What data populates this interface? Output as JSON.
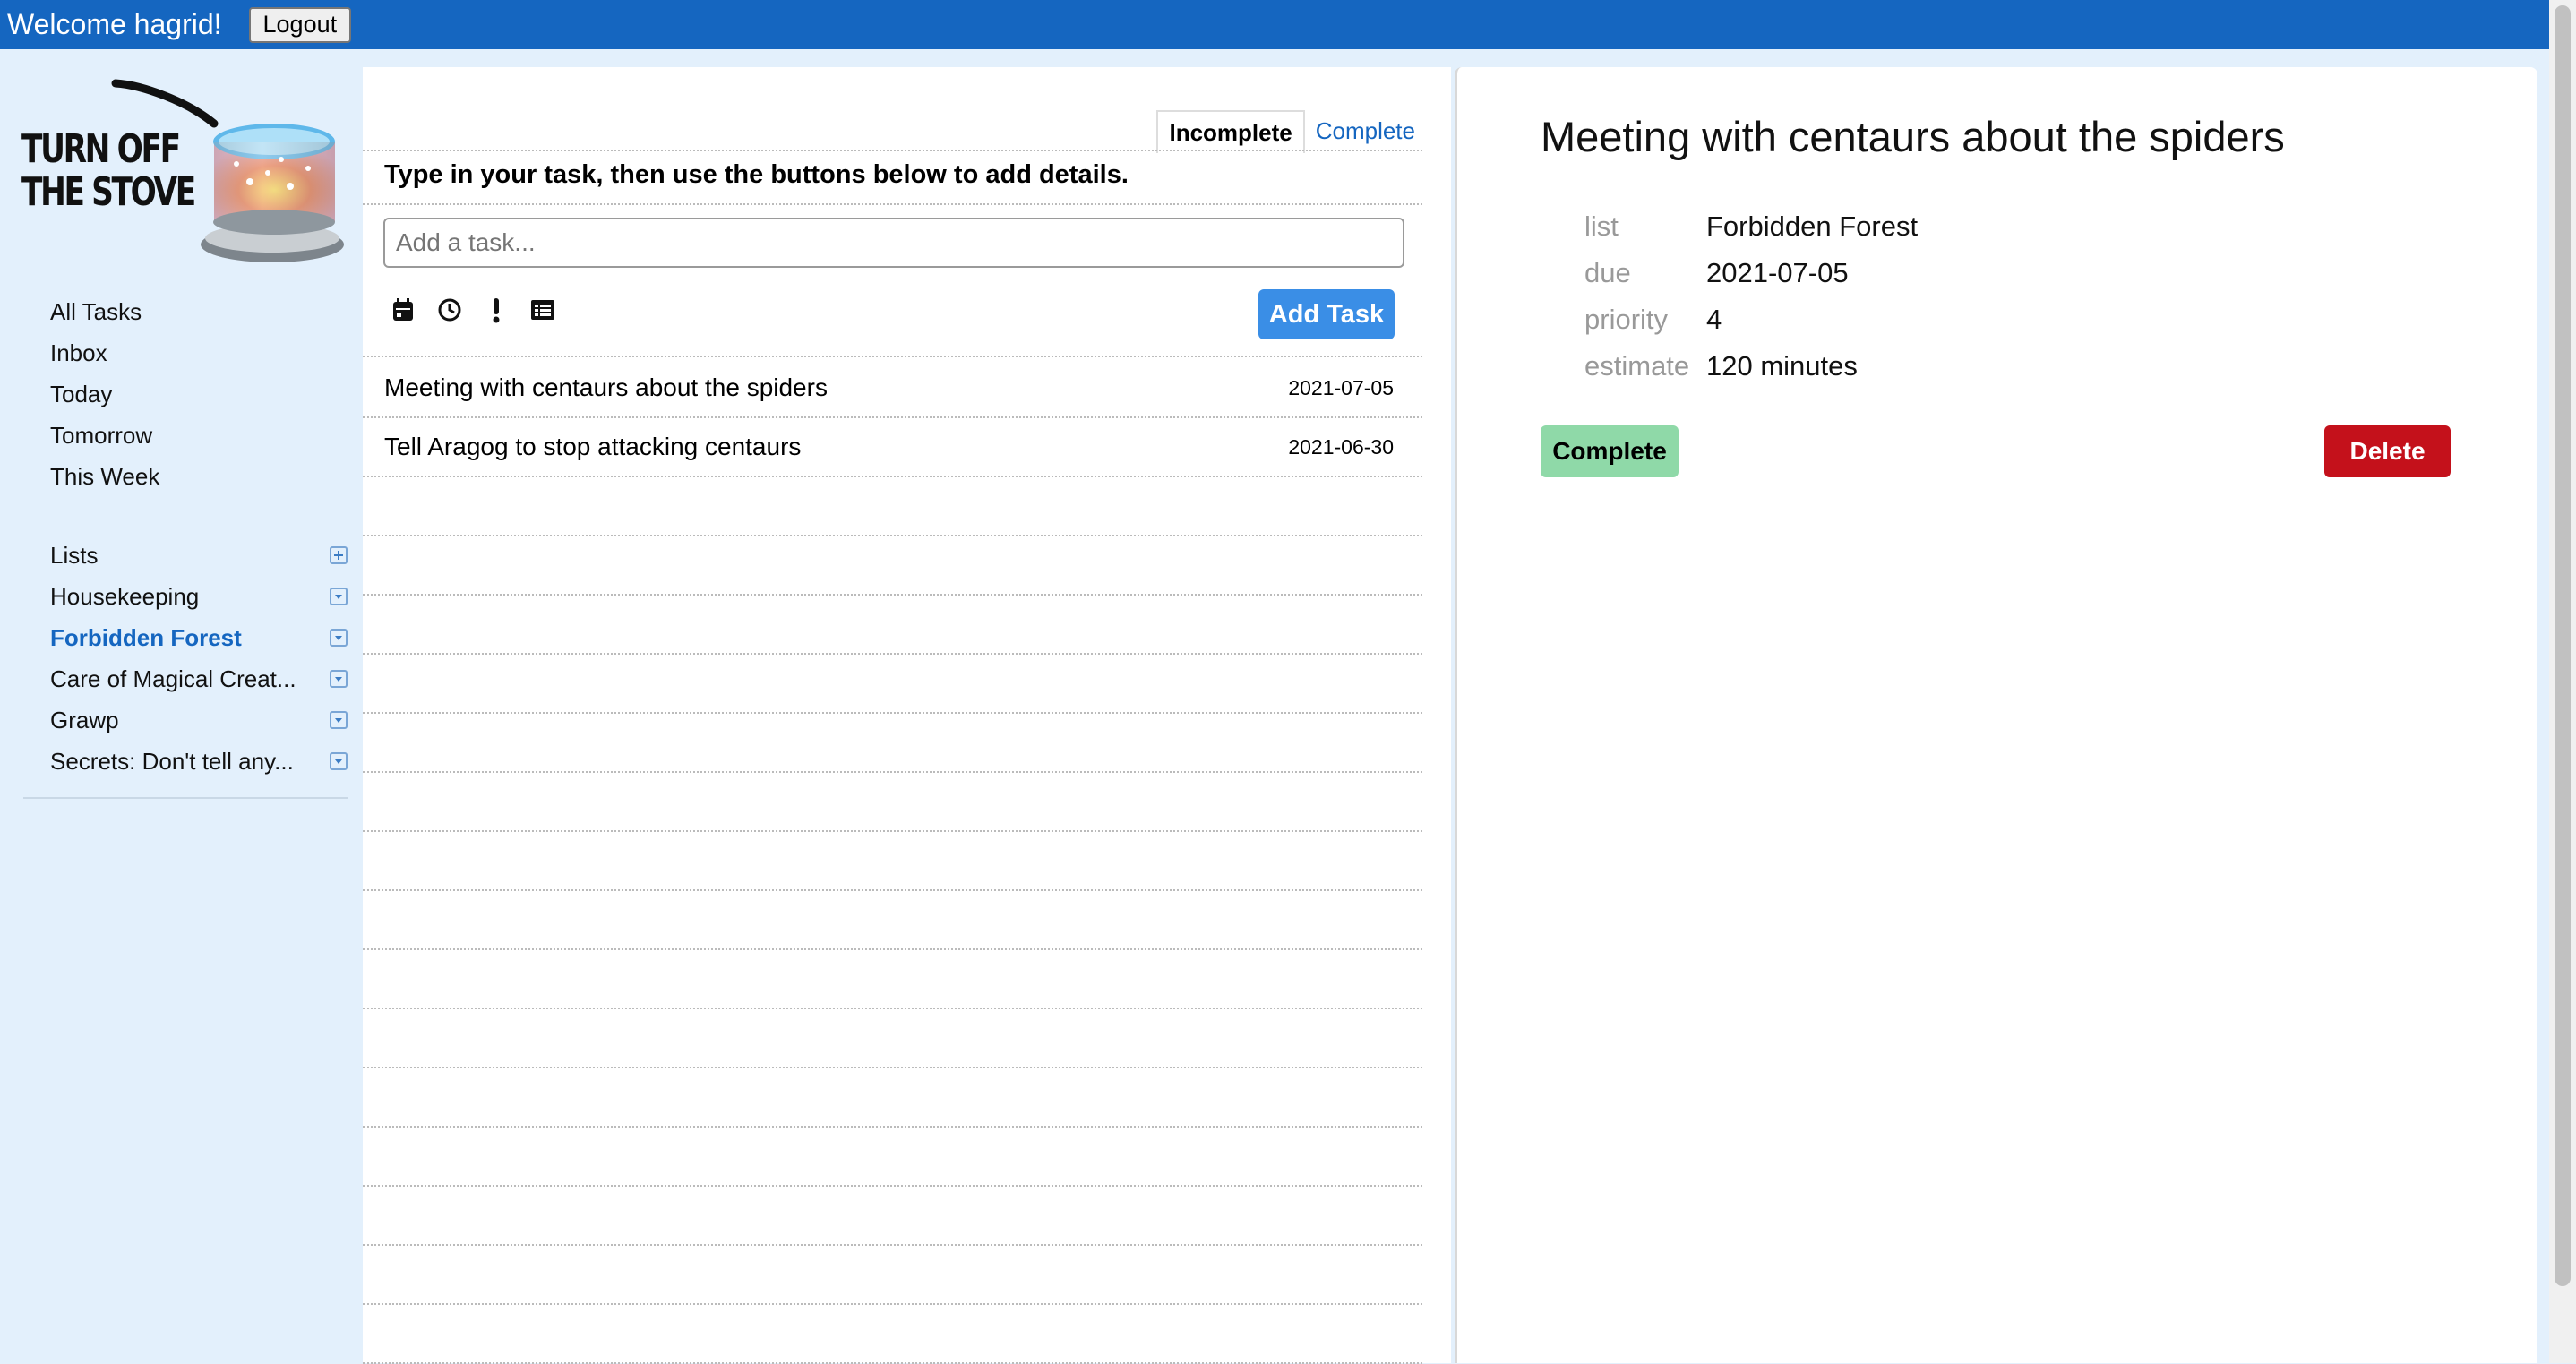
{
  "header": {
    "welcome": "Welcome hagrid!",
    "logout_label": "Logout"
  },
  "logo": {
    "line1": "TURN OFF",
    "line2": "THE STOVE"
  },
  "nav": {
    "items": [
      "All Tasks",
      "Inbox",
      "Today",
      "Tomorrow",
      "This Week"
    ]
  },
  "lists": {
    "header": "Lists",
    "items": [
      {
        "name": "Housekeeping",
        "active": false
      },
      {
        "name": "Forbidden Forest",
        "active": true
      },
      {
        "name": "Care of Magical Creat...",
        "active": false
      },
      {
        "name": "Grawp",
        "active": false
      },
      {
        "name": "Secrets: Don't tell any...",
        "active": false
      }
    ]
  },
  "tasks_panel": {
    "tabs": {
      "incomplete": "Incomplete",
      "complete": "Complete",
      "selected": "incomplete"
    },
    "instructions": "Type in your task, then use the buttons below to add details.",
    "input_placeholder": "Add a task...",
    "tool_icons": [
      "calendar-icon",
      "clock-icon",
      "priority-icon",
      "list-icon"
    ],
    "add_button": "Add Task",
    "tasks": [
      {
        "title": "Meeting with centaurs about the spiders",
        "due": "2021-07-05"
      },
      {
        "title": "Tell Aragog to stop attacking centaurs",
        "due": "2021-06-30"
      }
    ]
  },
  "detail": {
    "title": "Meeting with centaurs about the spiders",
    "fields": {
      "list": {
        "label": "list",
        "value": "Forbidden Forest"
      },
      "due": {
        "label": "due",
        "value": "2021-07-05"
      },
      "priority": {
        "label": "priority",
        "value": "4"
      },
      "estimate": {
        "label": "estimate",
        "value": "120 minutes"
      }
    },
    "complete_button": "Complete",
    "delete_button": "Delete"
  },
  "colors": {
    "header_bg": "#1566c0",
    "sidebar_bg": "#e3f0fc",
    "active_list": "#1566c0",
    "add_button": "#3a8ee6",
    "complete_button": "#8fd9a8",
    "delete_button": "#c4111b"
  }
}
